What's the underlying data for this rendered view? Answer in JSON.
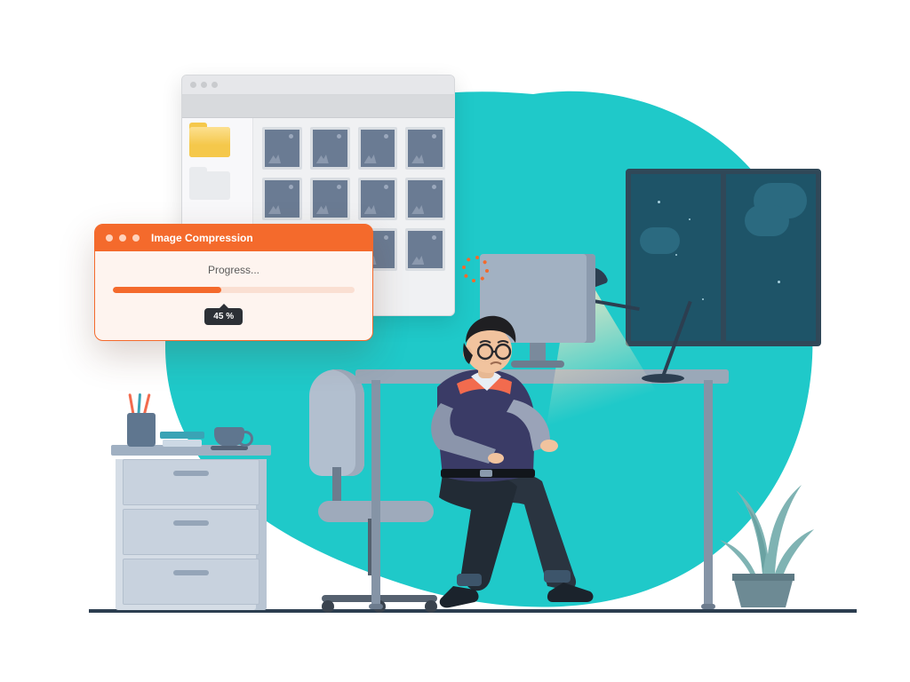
{
  "dialog": {
    "title": "Image Compression",
    "progress_label": "Progress...",
    "percent_value": 45,
    "percent_text": "45 %"
  },
  "browser": {
    "thumb_count": 12
  },
  "colors": {
    "accent": "#f46a2c",
    "teal": "#1fc9c9",
    "dark": "#2c3036"
  }
}
